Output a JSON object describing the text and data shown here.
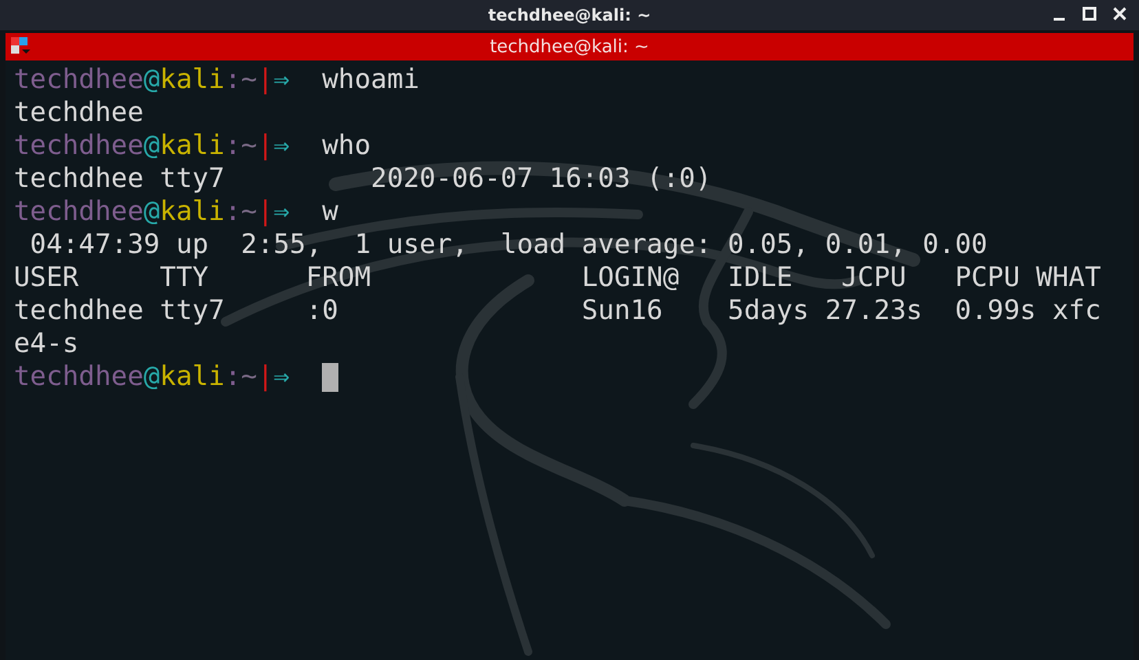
{
  "window": {
    "title": "techdhee@kali: ~"
  },
  "terminal_header": {
    "title": "techdhee@kali: ~"
  },
  "lines": [
    {
      "kind": "prompt",
      "user": "techdhee",
      "at": "@",
      "host": "kali",
      "colon": ":",
      "path": "~",
      "bar": "|",
      "arrow": "⇒",
      "command": "whoami"
    },
    {
      "kind": "output",
      "text": "techdhee"
    },
    {
      "kind": "prompt",
      "user": "techdhee",
      "at": "@",
      "host": "kali",
      "colon": ":",
      "path": "~",
      "bar": "|",
      "arrow": "⇒",
      "command": "who"
    },
    {
      "kind": "output",
      "text": "techdhee tty7         2020-06-07 16:03 (:0)"
    },
    {
      "kind": "prompt",
      "user": "techdhee",
      "at": "@",
      "host": "kali",
      "colon": ":",
      "path": "~",
      "bar": "|",
      "arrow": "⇒",
      "command": "w"
    },
    {
      "kind": "output",
      "text": " 04:47:39 up  2:55,  1 user,  load average: 0.05, 0.01, 0.00"
    },
    {
      "kind": "output",
      "text": "USER     TTY      FROM             LOGIN@   IDLE   JCPU   PCPU WHAT"
    },
    {
      "kind": "output",
      "text": "techdhee tty7     :0               Sun16    5days 27.23s  0.99s xfc"
    },
    {
      "kind": "output",
      "text": "e4-s"
    },
    {
      "kind": "prompt",
      "user": "techdhee",
      "at": "@",
      "host": "kali",
      "colon": ":",
      "path": "~",
      "bar": "|",
      "arrow": "⇒",
      "cursor": true
    }
  ]
}
